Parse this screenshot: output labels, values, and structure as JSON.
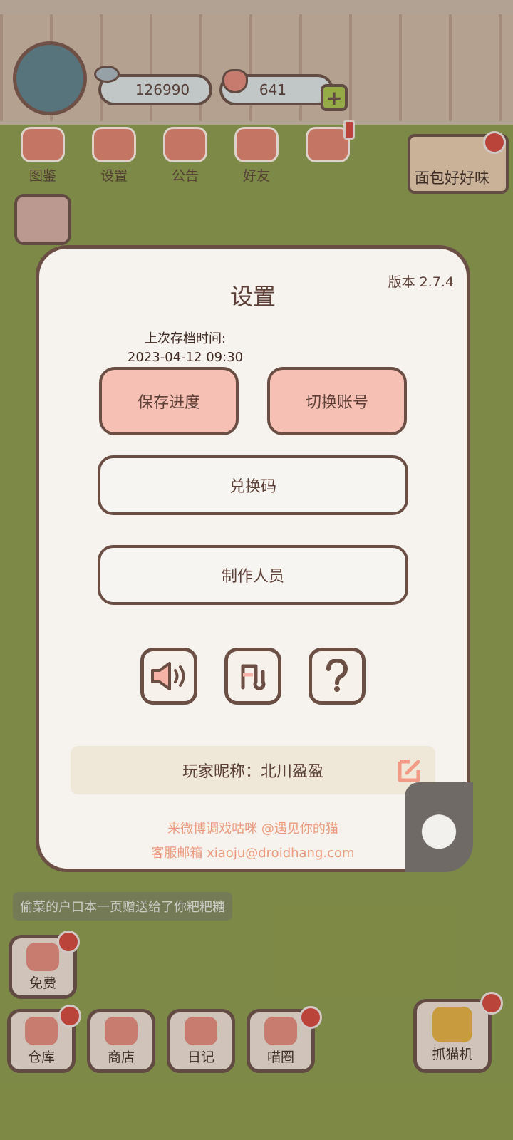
{
  "hud": {
    "coins": "126990",
    "hearts": "641"
  },
  "top_nav": [
    {
      "label": "图鉴"
    },
    {
      "label": "设置"
    },
    {
      "label": "公告"
    },
    {
      "label": "好友"
    }
  ],
  "event_banner": {
    "label": "面包好好味"
  },
  "settings": {
    "title": "设置",
    "version": "版本 2.7.4",
    "last_save_label": "上次存档时间:",
    "last_save_time": "2023-04-12 09:30",
    "save_button": "保存进度",
    "switch_account_button": "切换账号",
    "redeem_button": "兑换码",
    "credits_button": "制作人员",
    "nickname": "玩家昵称：北川盈盈",
    "weibo_line": "来微博调戏咕咪 @遇见你的猫",
    "email_line": "客服邮箱 xiaoju@droidhang.com"
  },
  "chat": {
    "line1": "偷菜的户口本一页赠送给了你粑粑糖"
  },
  "bottom_nav": [
    {
      "label": "免费"
    },
    {
      "label": "仓库"
    },
    {
      "label": "商店"
    },
    {
      "label": "日记"
    },
    {
      "label": "喵圈"
    },
    {
      "label": "抓猫机"
    }
  ],
  "colors": {
    "accent_pink": "#f7c0b4",
    "border_brown": "#6b4f44",
    "contact_text": "#eb9a7d",
    "badge_red": "#d6463a"
  }
}
